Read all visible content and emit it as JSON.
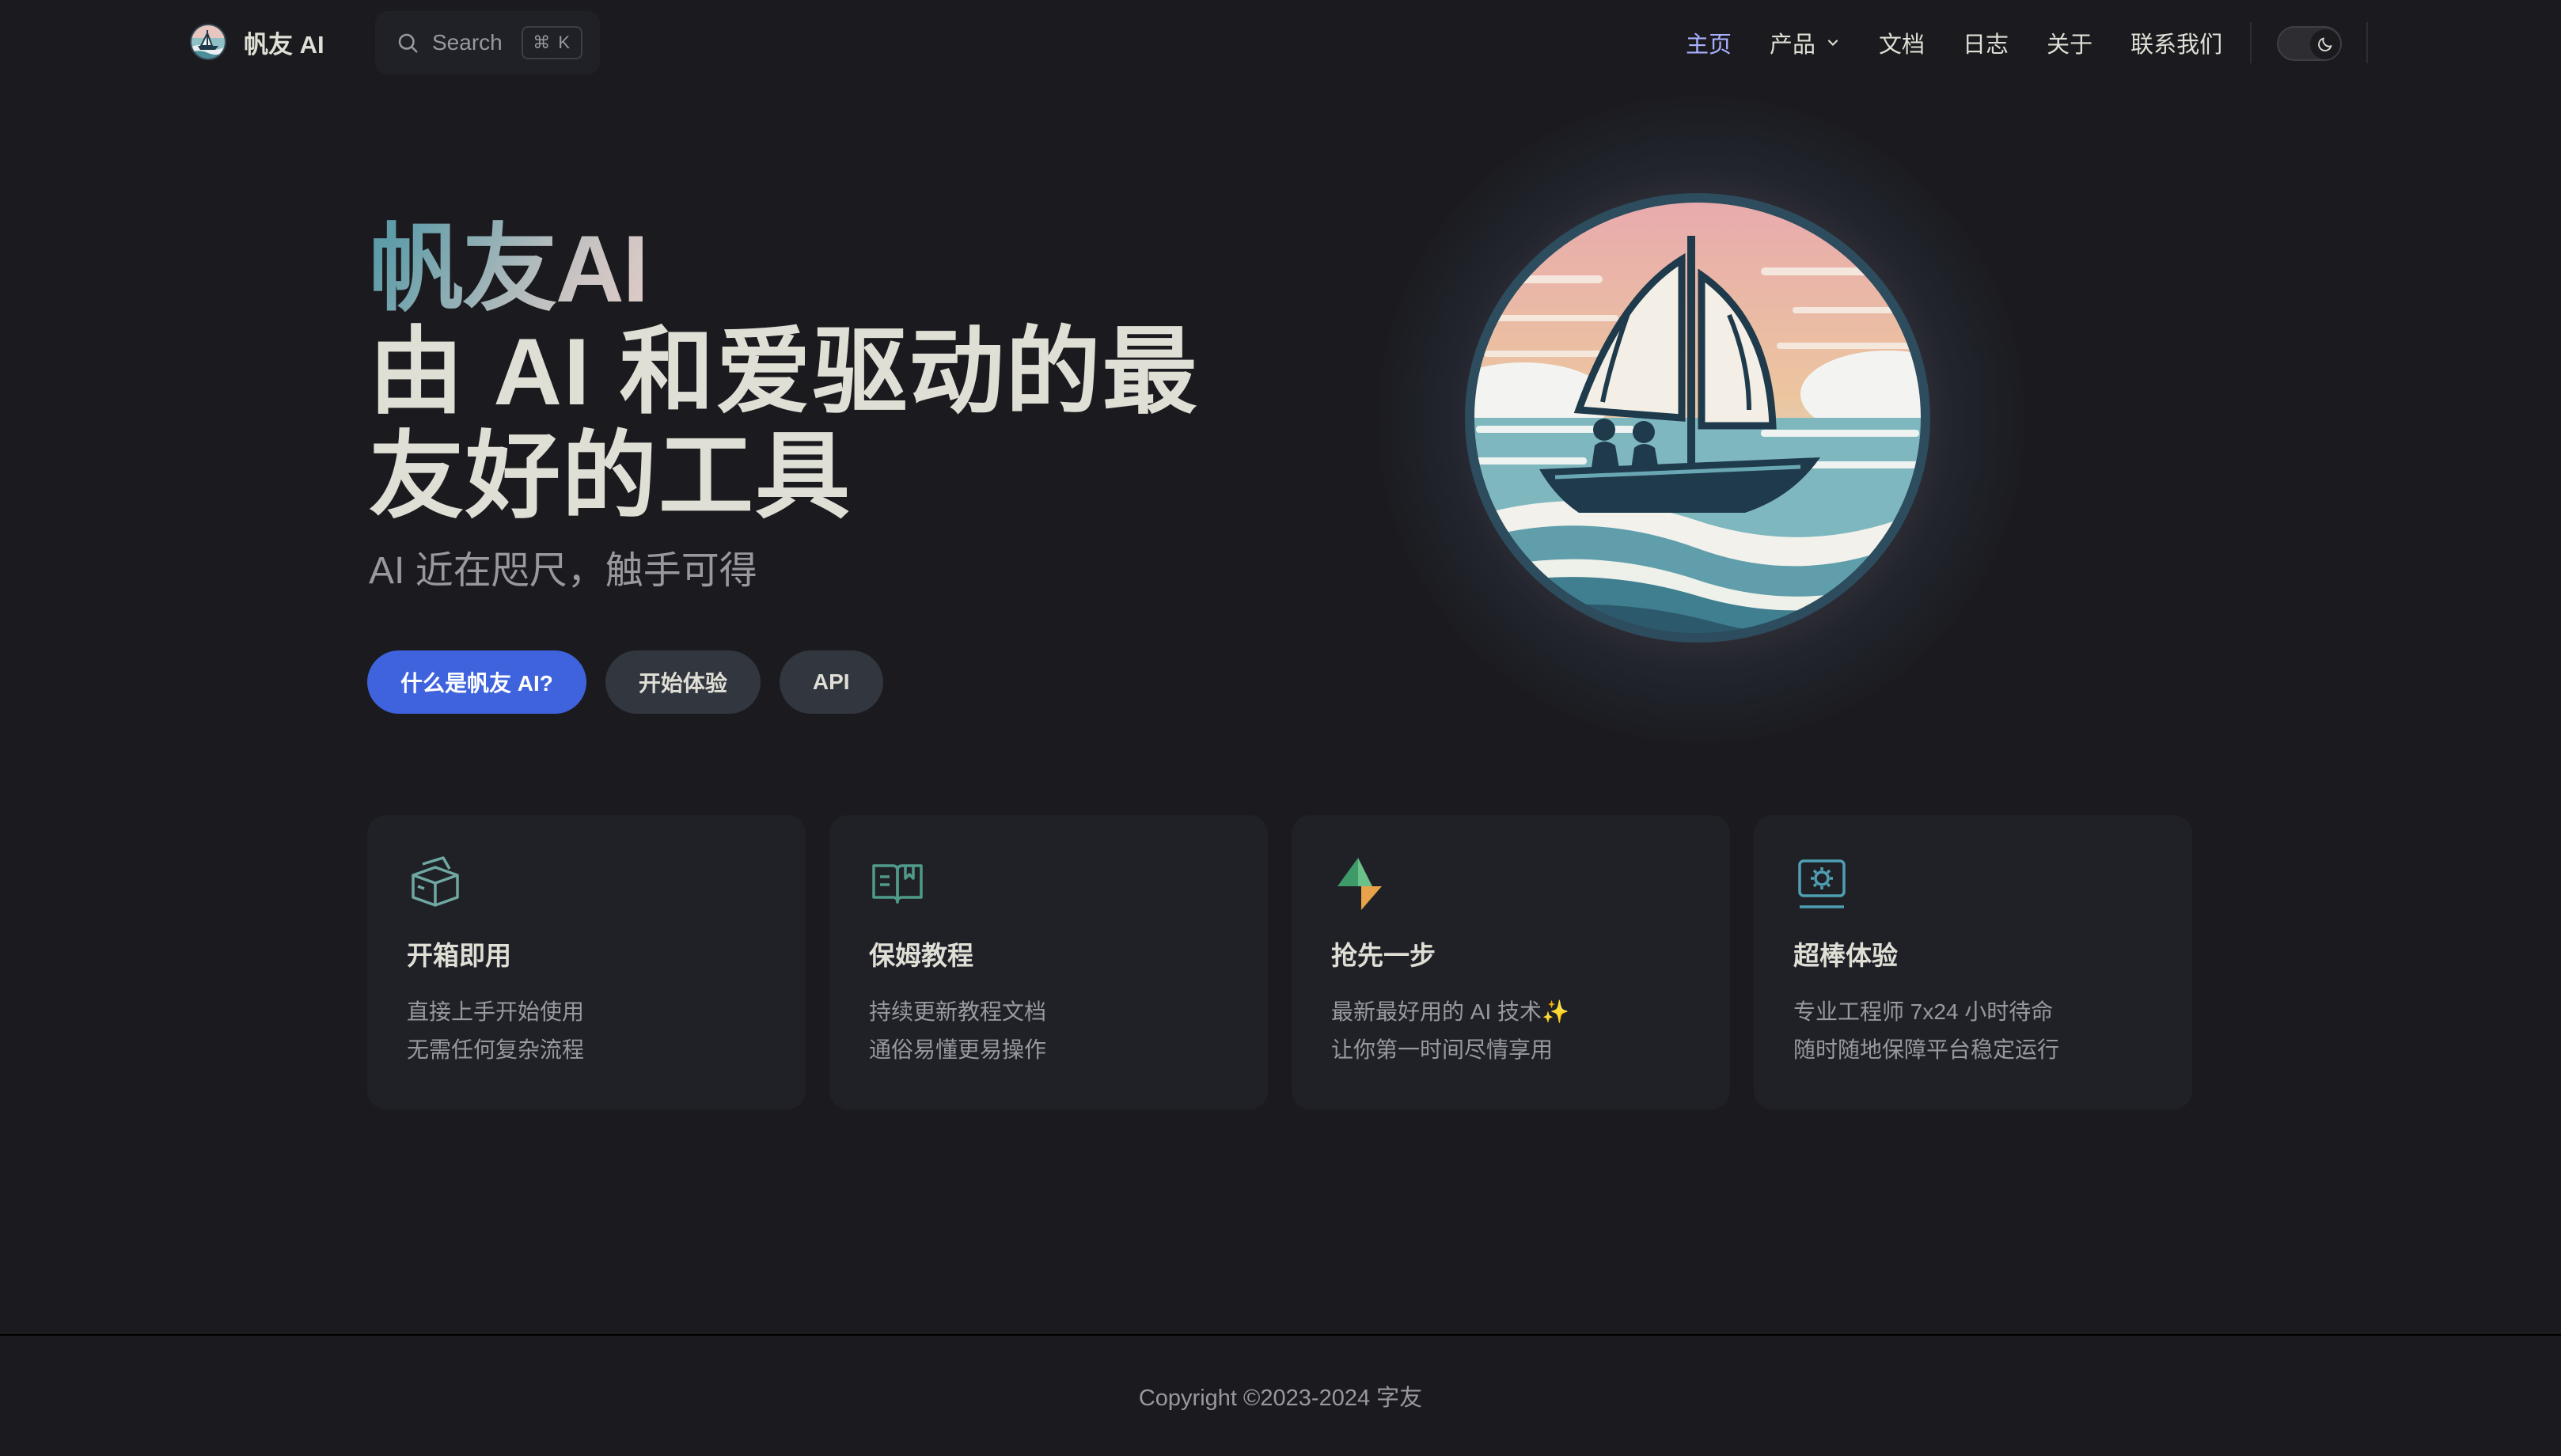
{
  "brand": {
    "name": "帆友 AI"
  },
  "search": {
    "label": "Search",
    "shortcut": "⌘ K"
  },
  "nav": {
    "items": [
      {
        "label": "主页",
        "active": true
      },
      {
        "label": "产品",
        "has_dropdown": true
      },
      {
        "label": "文档"
      },
      {
        "label": "日志"
      },
      {
        "label": "关于"
      },
      {
        "label": "联系我们"
      }
    ],
    "theme_toggle_icon": "moon-icon"
  },
  "hero": {
    "name": "帆友AI",
    "text": "由 AI 和爱驱动的最友好的工具",
    "tagline": "AI 近在咫尺，触手可得",
    "actions": [
      {
        "label": "什么是帆友 AI?",
        "theme": "brand"
      },
      {
        "label": "开始体验",
        "theme": "alt"
      },
      {
        "label": "API",
        "theme": "alt"
      }
    ]
  },
  "features": [
    {
      "icon": "box-icon",
      "title": "开箱即用",
      "details": [
        "直接上手开始使用",
        "无需任何复杂流程"
      ]
    },
    {
      "icon": "book-icon",
      "title": "保姆教程",
      "details": [
        "持续更新教程文档",
        "通俗易懂更易操作"
      ]
    },
    {
      "icon": "lightning-icon",
      "title": "抢先一步",
      "details": [
        "最新最好用的 AI 技术✨",
        "让你第一时间尽情享用"
      ]
    },
    {
      "icon": "monitor-gear-icon",
      "title": "超棒体验",
      "details": [
        "专业工程师 7x24 小时待命",
        "随时随地保障平台稳定运行"
      ]
    }
  ],
  "footer": {
    "copyright": "Copyright ©2023-2024 字友"
  },
  "colors": {
    "background": "#1b1b1f",
    "brand": "#3e63dd",
    "active_link": "#a8b1ff",
    "card": "#202127"
  }
}
